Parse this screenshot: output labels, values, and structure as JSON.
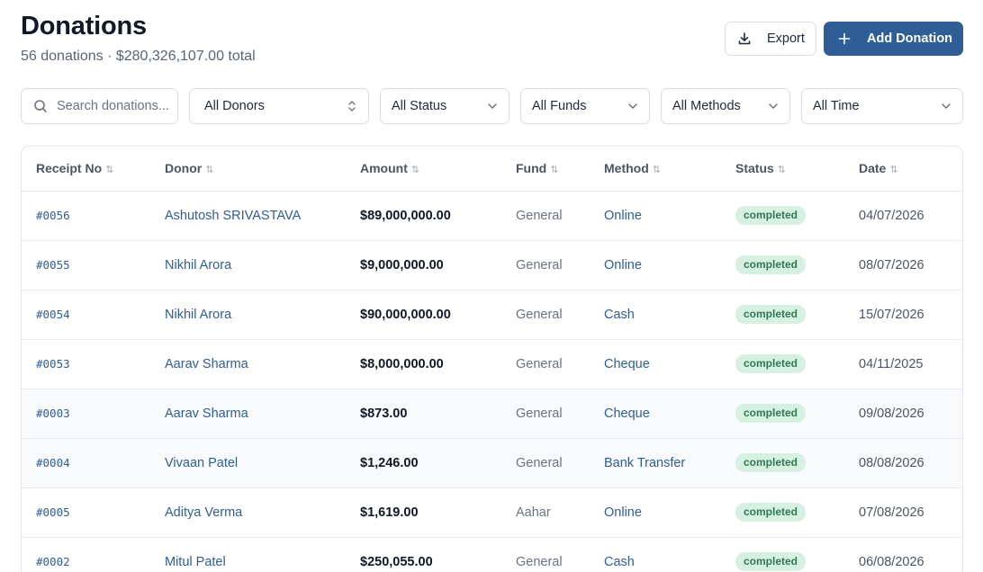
{
  "page": {
    "title": "Donations",
    "subtitle": "56 donations · $280,326,107.00 total"
  },
  "actions": {
    "export_label": "Export",
    "add_label": "Add Donation"
  },
  "filters": {
    "search_placeholder": "Search donations...",
    "donor": "All Donors",
    "status": "All Status",
    "fund": "All Funds",
    "method": "All Methods",
    "time": "All Time"
  },
  "table": {
    "headers": [
      "Receipt No",
      "Donor",
      "Amount",
      "Fund",
      "Method",
      "Status",
      "Date"
    ],
    "rows": [
      {
        "receipt": "#0056",
        "donor": "Ashutosh SRIVASTAVA",
        "amount": "$89,000,000.00",
        "fund": "General",
        "method": "Online",
        "status": "completed",
        "date": "04/07/2026"
      },
      {
        "receipt": "#0055",
        "donor": "Nikhil Arora",
        "amount": "$9,000,000.00",
        "fund": "General",
        "method": "Online",
        "status": "completed",
        "date": "08/07/2026"
      },
      {
        "receipt": "#0054",
        "donor": "Nikhil Arora",
        "amount": "$90,000,000.00",
        "fund": "General",
        "method": "Cash",
        "status": "completed",
        "date": "15/07/2026"
      },
      {
        "receipt": "#0053",
        "donor": "Aarav Sharma",
        "amount": "$8,000,000.00",
        "fund": "General",
        "method": "Cheque",
        "status": "completed",
        "date": "04/11/2025"
      },
      {
        "receipt": "#0003",
        "donor": "Aarav Sharma",
        "amount": "$873.00",
        "fund": "General",
        "method": "Cheque",
        "status": "completed",
        "date": "09/08/2026"
      },
      {
        "receipt": "#0004",
        "donor": "Vivaan Patel",
        "amount": "$1,246.00",
        "fund": "General",
        "method": "Bank Transfer",
        "status": "completed",
        "date": "08/08/2026"
      },
      {
        "receipt": "#0005",
        "donor": "Aditya Verma",
        "amount": "$1,619.00",
        "fund": "Aahar",
        "method": "Online",
        "status": "completed",
        "date": "07/08/2026"
      },
      {
        "receipt": "#0002",
        "donor": "Mitul Patel",
        "amount": "$250,055.00",
        "fund": "General",
        "method": "Cash",
        "status": "completed",
        "date": "06/08/2026"
      }
    ]
  }
}
